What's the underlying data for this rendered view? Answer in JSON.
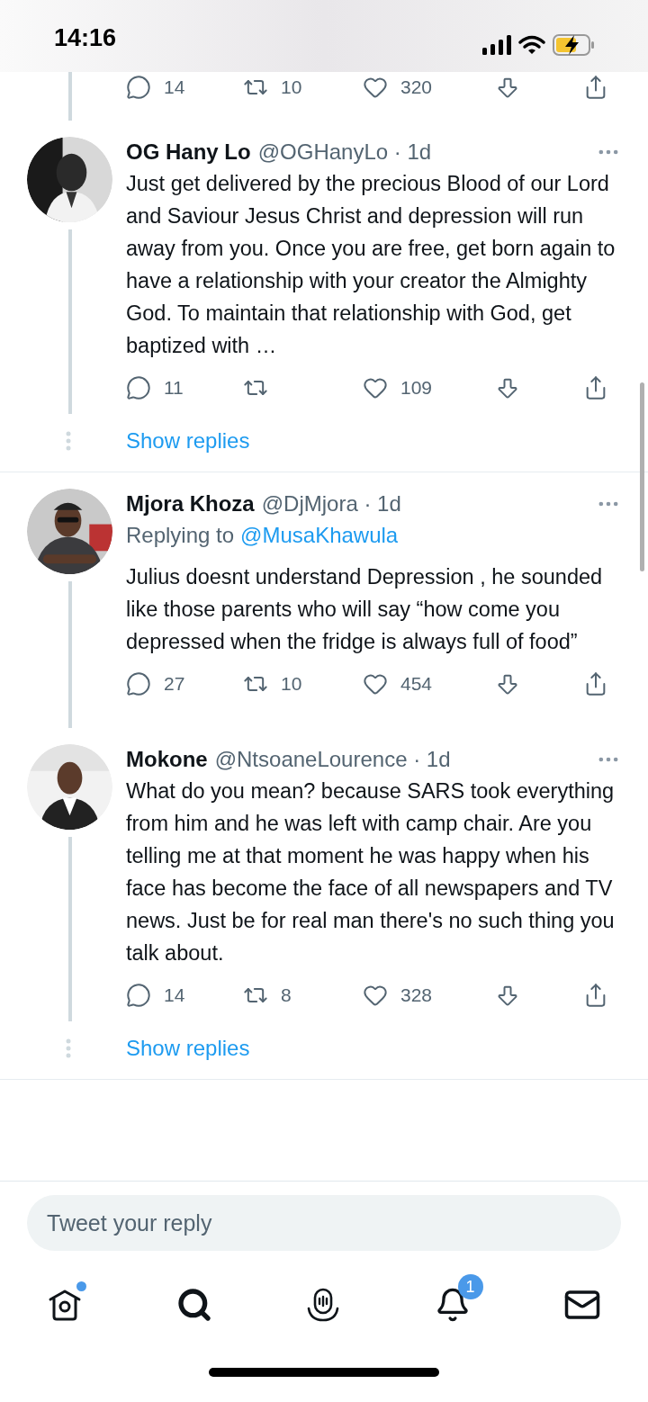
{
  "status_bar": {
    "time": "14:16"
  },
  "top_actions": [
    {
      "kind": "reply",
      "count": "14"
    },
    {
      "kind": "retweet",
      "count": "10"
    },
    {
      "kind": "like",
      "count": "320"
    },
    {
      "kind": "downvote"
    },
    {
      "kind": "share"
    }
  ],
  "tweets": [
    {
      "name": "OG Hany Lo",
      "meta": "@OGHanyLo · 1d",
      "text": "Just get delivered by the precious Blood of our Lord and Saviour Jesus Christ and depression will run away from you. Once you are free, get born again to have a relationship with your creator the Almighty God. To maintain that relationship with God, get baptized with …",
      "actions": [
        {
          "kind": "reply",
          "count": "11"
        },
        {
          "kind": "retweet"
        },
        {
          "kind": "like",
          "count": "109"
        },
        {
          "kind": "downvote"
        },
        {
          "kind": "share"
        }
      ],
      "show_replies": "Show replies"
    },
    {
      "name": "Mjora Khoza",
      "meta": "@DjMjora · 1d",
      "replying_prefix": "Replying to",
      "replying_to": "@MusaKhawula",
      "text": "Julius doesnt understand Depression , he sounded like those parents who will say “how come you depressed when the fridge is always full of food”",
      "actions": [
        {
          "kind": "reply",
          "count": "27"
        },
        {
          "kind": "retweet",
          "count": "10"
        },
        {
          "kind": "like",
          "count": "454"
        },
        {
          "kind": "downvote"
        },
        {
          "kind": "share"
        }
      ]
    },
    {
      "name": "Mokone",
      "meta": "@NtsoaneLourence · 1d",
      "text": "What do you mean? because SARS took everything from him and he was left with camp chair. Are you telling me at that moment he was happy when his face has become the face of all newspapers and TV news. Just be for real man there's no such thing you talk about.",
      "actions": [
        {
          "kind": "reply",
          "count": "14"
        },
        {
          "kind": "retweet",
          "count": "8"
        },
        {
          "kind": "like",
          "count": "328"
        },
        {
          "kind": "downvote"
        },
        {
          "kind": "share"
        }
      ],
      "show_replies": "Show replies"
    }
  ],
  "reply_field": {
    "placeholder": "Tweet your reply"
  },
  "nav": [
    {
      "kind": "home",
      "dot": true
    },
    {
      "kind": "search"
    },
    {
      "kind": "spaces"
    },
    {
      "kind": "notifications",
      "badge": "1"
    },
    {
      "kind": "messages"
    }
  ]
}
